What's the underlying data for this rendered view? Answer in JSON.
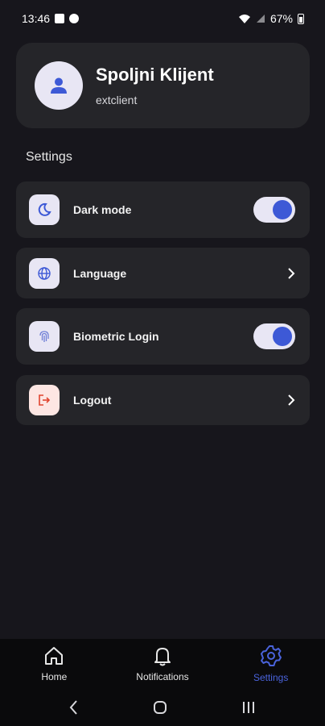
{
  "status_bar": {
    "time": "13:46",
    "battery": "67%"
  },
  "profile": {
    "name": "Spoljni Klijent",
    "username": "extclient"
  },
  "section_title": "Settings",
  "settings": [
    {
      "label": "Dark mode",
      "icon": "moon-icon",
      "control": "toggle",
      "enabled": true
    },
    {
      "label": "Language",
      "icon": "globe-icon",
      "control": "chevron"
    },
    {
      "label": "Biometric Login",
      "icon": "fingerprint-icon",
      "control": "toggle",
      "enabled": true
    },
    {
      "label": "Logout",
      "icon": "logout-icon",
      "control": "chevron"
    }
  ],
  "bottom_nav": [
    {
      "label": "Home",
      "icon": "home-icon",
      "active": false
    },
    {
      "label": "Notifications",
      "icon": "bell-icon",
      "active": false
    },
    {
      "label": "Settings",
      "icon": "gear-icon",
      "active": true
    }
  ],
  "colors": {
    "accent": "#3d59d6",
    "background": "#17161c",
    "card": "#252529",
    "icon_bg": "#e8e6f4",
    "logout_icon_bg": "#fde6e3",
    "logout_icon": "#e0442e"
  }
}
